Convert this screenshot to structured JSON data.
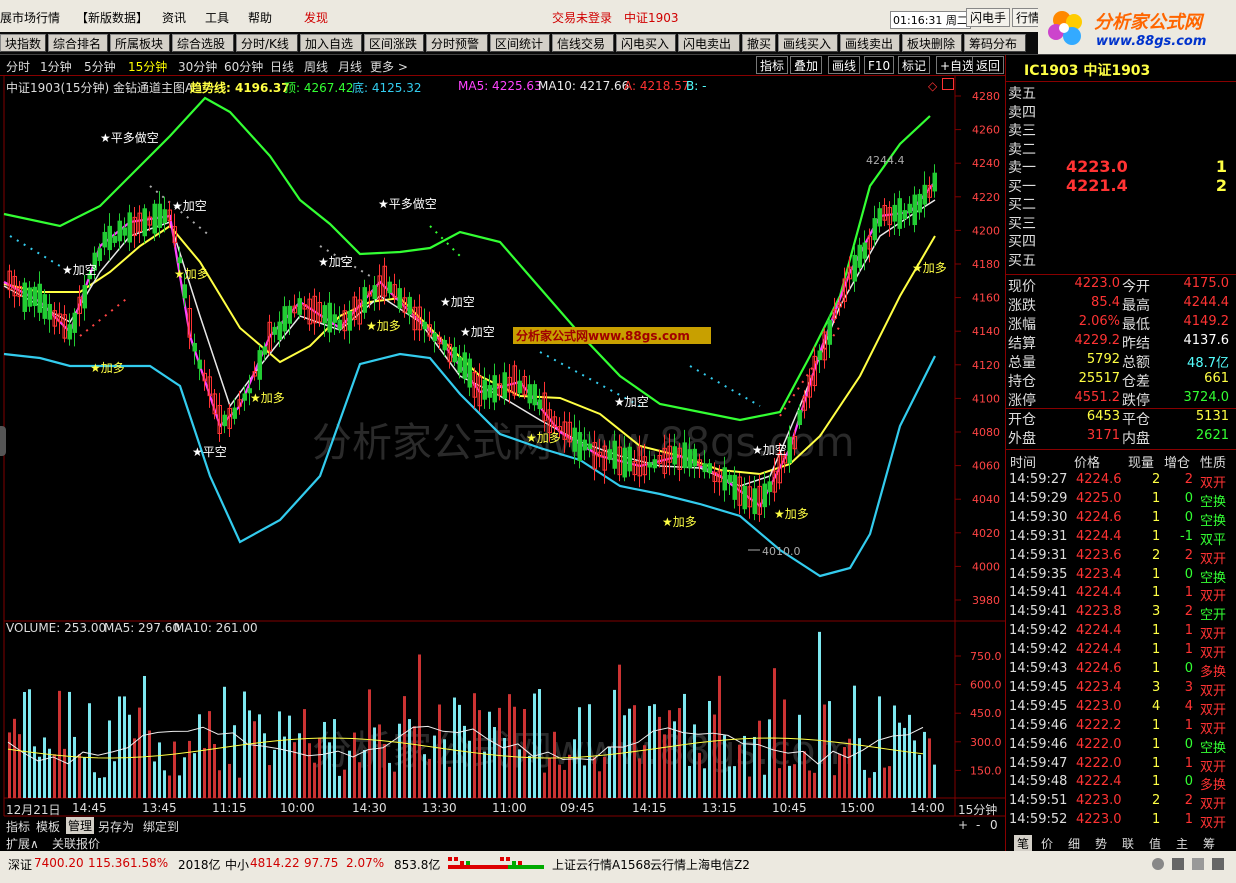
{
  "menu": {
    "items": [
      "展市场行情",
      "【新版数据】",
      "资讯",
      "工具",
      "帮助"
    ],
    "discover": "发现",
    "login_status": "交易未登录",
    "current_contract": "中证1903",
    "clock": "01:16:31 周二",
    "btn_flash": "闪电手",
    "btn_market": "行情",
    "brand": "分析家公式网",
    "brand_url": "www.88gs.com"
  },
  "toolbar": {
    "buttons": [
      "块指数",
      "综合排名",
      "所属板块",
      "综合选股",
      "分时/K线",
      "加入自选",
      "区间涨跌",
      "分时预警",
      "区间统计",
      "信线交易",
      "闪电买入",
      "闪电卖出",
      "撤买",
      "画线买入",
      "画线卖出",
      "板块删除",
      "筹码分布"
    ]
  },
  "periods": {
    "items": [
      "分时",
      "1分钟",
      "5分钟",
      "15分钟",
      "30分钟",
      "60分钟",
      "日线",
      "周线",
      "月线",
      "更多 >"
    ],
    "active_index": 3,
    "right_buttons": [
      "指标",
      "叠加",
      "画线",
      "F10",
      "标记",
      "+自选",
      "返回"
    ]
  },
  "main_chart": {
    "title": "中证1903(15分钟) 金钻通道主图A",
    "trend_label": "趋势线: 4196.37",
    "top_label": "顶: 4267.42",
    "bottom_label": "底: 4125.32",
    "ma5_label": "MA5: 4225.63",
    "ma10_label": "MA10: 4217.66",
    "a_label": "A: 4218.57",
    "b_label": "B: -",
    "y_ticks": [
      "4280",
      "4260",
      "4240",
      "4220",
      "4200",
      "4180",
      "4160",
      "4140",
      "4120",
      "4100",
      "4080",
      "4060",
      "4040",
      "4020",
      "4000",
      "3980"
    ],
    "max_label": "4244.4",
    "min_label": "4010.0",
    "watermark_box": "分析家公式网www.88gs.com",
    "watermark": "分析家公式网www.88gs.com",
    "signals": [
      {
        "text": "平多做空",
        "type": "sell"
      },
      {
        "text": "加空",
        "type": "sell"
      },
      {
        "text": "加空",
        "type": "sell"
      },
      {
        "text": "加多",
        "type": "buy"
      },
      {
        "text": "加多",
        "type": "buy"
      },
      {
        "text": "平空",
        "type": "sell"
      },
      {
        "text": "加多",
        "type": "buy"
      },
      {
        "text": "加空",
        "type": "sell"
      },
      {
        "text": "平多做空",
        "type": "sell"
      },
      {
        "text": "加多",
        "type": "buy"
      },
      {
        "text": "加空",
        "type": "sell"
      },
      {
        "text": "加空",
        "type": "sell"
      },
      {
        "text": "加多",
        "type": "buy"
      },
      {
        "text": "加空",
        "type": "sell"
      },
      {
        "text": "加多",
        "type": "buy"
      },
      {
        "text": "加空",
        "type": "sell"
      },
      {
        "text": "加多",
        "type": "buy"
      },
      {
        "text": "加多",
        "type": "buy"
      }
    ]
  },
  "volume_chart": {
    "title": "VOLUME: 253.00",
    "ma5_label": "MA5: 297.60",
    "ma10_label": "MA10: 261.00",
    "y_ticks": [
      "750.0",
      "600.0",
      "450.0",
      "300.0",
      "150.0"
    ]
  },
  "x_axis": {
    "labels": [
      "12月21日",
      "14:45",
      "13:45",
      "11:15",
      "10:00",
      "14:30",
      "13:30",
      "11:00",
      "09:45",
      "14:15",
      "13:15",
      "10:45",
      "15:00",
      "14:00"
    ],
    "period": "15分钟"
  },
  "bottom_tabs": {
    "items": [
      "指标",
      "模板",
      "管理",
      "另存为",
      "绑定到"
    ],
    "active_index": 2,
    "row2": [
      "扩展∧",
      "关联报价"
    ]
  },
  "right_panel": {
    "title": "IC1903 中证1903",
    "order_book": [
      {
        "label": "卖五",
        "price": "",
        "qty": ""
      },
      {
        "label": "卖四",
        "price": "",
        "qty": ""
      },
      {
        "label": "卖三",
        "price": "",
        "qty": ""
      },
      {
        "label": "卖二",
        "price": "",
        "qty": ""
      },
      {
        "label": "卖一",
        "price": "4223.0",
        "qty": "1"
      },
      {
        "label": "买一",
        "price": "4221.4",
        "qty": "2"
      },
      {
        "label": "买二",
        "price": "",
        "qty": ""
      },
      {
        "label": "买三",
        "price": "",
        "qty": ""
      },
      {
        "label": "买四",
        "price": "",
        "qty": ""
      },
      {
        "label": "买五",
        "price": "",
        "qty": ""
      }
    ],
    "stats": [
      [
        "现价",
        "4223.0",
        "今开",
        "4175.0"
      ],
      [
        "涨跌",
        "85.4",
        "最高",
        "4244.4"
      ],
      [
        "涨幅",
        "2.06%",
        "最低",
        "4149.2"
      ],
      [
        "结算",
        "4229.2",
        "昨结",
        "4137.6"
      ],
      [
        "总量",
        "5792",
        "总额",
        "48.7亿"
      ],
      [
        "持仓",
        "25517",
        "仓差",
        "661"
      ],
      [
        "涨停",
        "4551.2",
        "跌停",
        "3724.0"
      ]
    ],
    "stats2": [
      [
        "开仓",
        "6453",
        "平仓",
        "5131"
      ],
      [
        "外盘",
        "3171",
        "内盘",
        "2621"
      ]
    ],
    "trade_headers": [
      "时间",
      "价格",
      "现量",
      "增仓",
      "性质"
    ],
    "trades": [
      [
        "14:59:27",
        "4224.6",
        "2",
        "2",
        "双开"
      ],
      [
        "14:59:29",
        "4225.0",
        "1",
        "0",
        "空换"
      ],
      [
        "14:59:30",
        "4224.6",
        "1",
        "0",
        "空换"
      ],
      [
        "14:59:31",
        "4224.4",
        "1",
        "-1",
        "双平"
      ],
      [
        "14:59:31",
        "4223.6",
        "2",
        "2",
        "双开"
      ],
      [
        "14:59:35",
        "4223.4",
        "1",
        "0",
        "空换"
      ],
      [
        "14:59:41",
        "4224.4",
        "1",
        "1",
        "双开"
      ],
      [
        "14:59:41",
        "4223.8",
        "3",
        "2",
        "空开"
      ],
      [
        "14:59:42",
        "4224.4",
        "1",
        "1",
        "双开"
      ],
      [
        "14:59:42",
        "4224.4",
        "1",
        "1",
        "双开"
      ],
      [
        "14:59:43",
        "4224.6",
        "1",
        "0",
        "多换"
      ],
      [
        "14:59:45",
        "4223.4",
        "3",
        "3",
        "双开"
      ],
      [
        "14:59:45",
        "4223.0",
        "4",
        "4",
        "双开"
      ],
      [
        "14:59:46",
        "4222.2",
        "1",
        "1",
        "双开"
      ],
      [
        "14:59:46",
        "4222.0",
        "1",
        "0",
        "空换"
      ],
      [
        "14:59:47",
        "4222.0",
        "1",
        "1",
        "双开"
      ],
      [
        "14:59:48",
        "4222.4",
        "1",
        "0",
        "多换"
      ],
      [
        "14:59:51",
        "4223.0",
        "2",
        "2",
        "双开"
      ],
      [
        "14:59:52",
        "4223.0",
        "1",
        "1",
        "双开"
      ]
    ],
    "bottom_tabs": [
      "笔",
      "价",
      "细",
      "势",
      "联",
      "值",
      "主",
      "筹"
    ]
  },
  "status_bar": {
    "sz_label": "深证",
    "sz_value": "7400.20",
    "sz_change": "115.36",
    "sz_pct": "1.58%",
    "sz_amount": "2018亿",
    "zx_label": "中小",
    "zx_value": "4814.22",
    "zx_change": "97.75",
    "zx_pct": "2.07%",
    "zx_amount": "853.8亿",
    "cloud1": "上证云行情A1568",
    "cloud2": "云行情上海电信Z2"
  },
  "colors": {
    "up": "#ff3333",
    "down": "#54ffff",
    "upper_band": "#33ff33",
    "lower_band": "#33ccee",
    "trend": "#ffff44",
    "ma5": "#ff44ff",
    "ma10": "#e8e8e8",
    "grid_red": "#800000"
  }
}
